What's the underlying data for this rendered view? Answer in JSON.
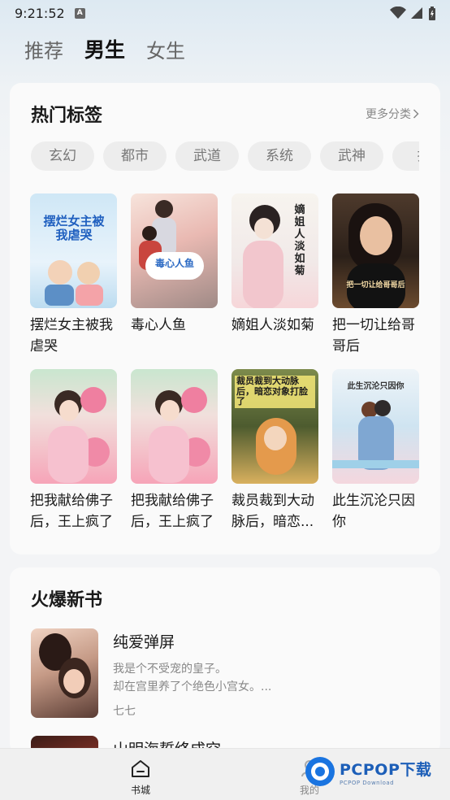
{
  "status": {
    "time": "9:21:52",
    "notif_letter": "A"
  },
  "top_tabs": [
    {
      "label": "推荐",
      "active": false
    },
    {
      "label": "男生",
      "active": true
    },
    {
      "label": "女生",
      "active": false
    }
  ],
  "hot": {
    "title": "热门标签",
    "more": "更多分类",
    "tags": [
      "玄幻",
      "都市",
      "武道",
      "系统",
      "武神",
      "护"
    ],
    "books": [
      {
        "title": "摆烂女主被我虐哭",
        "cover_text": "摆烂女主被我虐哭"
      },
      {
        "title": "毒心人鱼",
        "cover_text": "毒心人鱼"
      },
      {
        "title": "嫡姐人淡如菊",
        "cover_text": "嫡姐人淡如菊"
      },
      {
        "title": "把一切让给哥哥后",
        "cover_text": "把一切让给哥哥后"
      },
      {
        "title": "把我献给佛子后，王上疯了",
        "cover_text": ""
      },
      {
        "title": "把我献给佛子后，王上疯了",
        "cover_text": ""
      },
      {
        "title": "裁员裁到大动脉后，暗恋...",
        "cover_text": "裁员裁到大动脉后，暗恋对象打脸了"
      },
      {
        "title": "此生沉沦只因你",
        "cover_text": "此生沉沦只因你"
      }
    ]
  },
  "new_books": {
    "title": "火爆新书",
    "items": [
      {
        "title": "纯爱弹屏",
        "desc_line1": "我是个不受宠的皇子。",
        "desc_line2": "却在宫里养了个绝色小宫女。...",
        "author": "七七"
      },
      {
        "title": "山明海誓终成空"
      }
    ]
  },
  "bottom_nav": [
    {
      "label": "书城",
      "icon": "home-icon",
      "active": true
    },
    {
      "label": "我的",
      "icon": "user-icon",
      "active": false
    }
  ],
  "watermark": {
    "main": "PCPOP下载",
    "sub": "PCPOP Download"
  },
  "colors": {
    "accent": "#1a74e0",
    "background": "#f3f4f6",
    "card": "#fafafa"
  }
}
